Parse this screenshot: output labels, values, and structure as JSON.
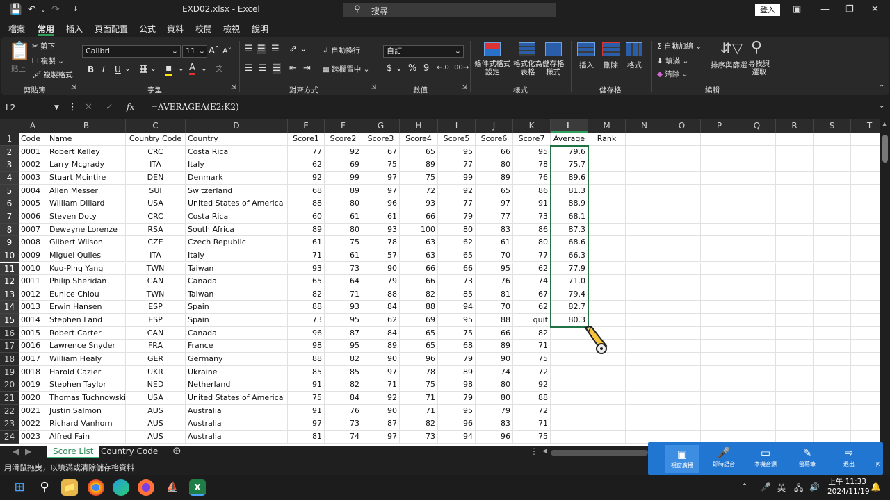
{
  "titlebar": {
    "doc_title": "EXD02.xlsx  -  Excel",
    "search_placeholder": "搜尋",
    "login_label": "登入"
  },
  "menu": {
    "tabs": [
      "檔案",
      "常用",
      "插入",
      "頁面配置",
      "公式",
      "資料",
      "校閱",
      "檢視",
      "說明"
    ],
    "active": "常用",
    "share_label": "共用"
  },
  "ribbon": {
    "clipboard": {
      "paste": "貼上",
      "cut": "剪下",
      "copy": "複製",
      "format_painter": "複製格式",
      "group": "剪貼簿"
    },
    "font": {
      "name": "Calibri",
      "size": "11",
      "group": "字型",
      "bold": "B",
      "italic": "I",
      "underline": "U"
    },
    "alignment": {
      "wrap": "自動換行",
      "merge": "跨欄置中",
      "group": "對齊方式"
    },
    "number": {
      "format": "自訂",
      "group": "數值",
      "currency": "$",
      "percent": "%",
      "comma": "9"
    },
    "styles": {
      "conditional": "條件式格式\n設定",
      "as_table": "格式化為\n表格",
      "cell_styles": "儲存格\n樣式",
      "group": "樣式"
    },
    "cells": {
      "insert": "插入",
      "delete": "刪除",
      "format": "格式",
      "group": "儲存格"
    },
    "editing": {
      "autosum": "自動加總",
      "fill": "填滿",
      "clear": "清除",
      "sort": "排序與篩選",
      "find": "尋找與\n選取",
      "group": "編輯"
    }
  },
  "formula_bar": {
    "name_box": "L2",
    "formula": "=AVERAGEA(E2:K2)",
    "fx": "fx"
  },
  "columns": [
    "A",
    "B",
    "C",
    "D",
    "E",
    "F",
    "G",
    "H",
    "I",
    "J",
    "K",
    "L",
    "M",
    "N",
    "O",
    "P",
    "Q",
    "R",
    "S",
    "T"
  ],
  "headers": [
    "Code",
    "Name",
    "Country Code",
    "Country",
    "Score1",
    "Score2",
    "Score3",
    "Score4",
    "Score5",
    "Score6",
    "Score7",
    "Average",
    "Rank"
  ],
  "rows": [
    [
      "0001",
      "Robert Kelley",
      "CRC",
      "Costa Rica",
      "77",
      "92",
      "67",
      "65",
      "95",
      "66",
      "95",
      "79.6"
    ],
    [
      "0002",
      "Larry Mcgrady",
      "ITA",
      "Italy",
      "62",
      "69",
      "75",
      "89",
      "77",
      "80",
      "78",
      "75.7"
    ],
    [
      "0003",
      "Stuart Mcintire",
      "DEN",
      "Denmark",
      "92",
      "99",
      "97",
      "75",
      "99",
      "89",
      "76",
      "89.6"
    ],
    [
      "0004",
      "Allen Messer",
      "SUI",
      "Switzerland",
      "68",
      "89",
      "97",
      "72",
      "92",
      "65",
      "86",
      "81.3"
    ],
    [
      "0005",
      "William Dillard",
      "USA",
      "United States of America",
      "88",
      "80",
      "96",
      "93",
      "77",
      "97",
      "91",
      "88.9"
    ],
    [
      "0006",
      "Steven Doty",
      "CRC",
      "Costa Rica",
      "60",
      "61",
      "61",
      "66",
      "79",
      "77",
      "73",
      "68.1"
    ],
    [
      "0007",
      "Dewayne Lorenze",
      "RSA",
      "South Africa",
      "89",
      "80",
      "93",
      "100",
      "80",
      "83",
      "86",
      "87.3"
    ],
    [
      "0008",
      "Gilbert Wilson",
      "CZE",
      "Czech Republic",
      "61",
      "75",
      "78",
      "63",
      "62",
      "61",
      "80",
      "68.6"
    ],
    [
      "0009",
      "Miguel Quiles",
      "ITA",
      "Italy",
      "71",
      "61",
      "57",
      "63",
      "65",
      "70",
      "77",
      "66.3"
    ],
    [
      "0010",
      "Kuo-Ping Yang",
      "TWN",
      "Taiwan",
      "93",
      "73",
      "90",
      "66",
      "66",
      "95",
      "62",
      "77.9"
    ],
    [
      "0011",
      "Philip Sheridan",
      "CAN",
      "Canada",
      "65",
      "64",
      "79",
      "66",
      "73",
      "76",
      "74",
      "71.0"
    ],
    [
      "0012",
      "Eunice Chiou",
      "TWN",
      "Taiwan",
      "82",
      "71",
      "88",
      "82",
      "85",
      "81",
      "67",
      "79.4"
    ],
    [
      "0013",
      "Erwin Hansen",
      "ESP",
      "Spain",
      "88",
      "93",
      "84",
      "88",
      "94",
      "70",
      "62",
      "82.7"
    ],
    [
      "0014",
      "Stephen Land",
      "ESP",
      "Spain",
      "73",
      "95",
      "62",
      "69",
      "95",
      "88",
      "quit",
      "80.3"
    ],
    [
      "0015",
      "Robert Carter",
      "CAN",
      "Canada",
      "96",
      "87",
      "84",
      "65",
      "75",
      "66",
      "82",
      ""
    ],
    [
      "0016",
      "Lawrence Snyder",
      "FRA",
      "France",
      "98",
      "95",
      "89",
      "65",
      "68",
      "89",
      "71",
      ""
    ],
    [
      "0017",
      "William Healy",
      "GER",
      "Germany",
      "88",
      "82",
      "90",
      "96",
      "79",
      "90",
      "75",
      ""
    ],
    [
      "0018",
      "Harold Cazier",
      "UKR",
      "Ukraine",
      "85",
      "85",
      "97",
      "78",
      "89",
      "74",
      "72",
      ""
    ],
    [
      "0019",
      "Stephen Taylor",
      "NED",
      "Netherland",
      "91",
      "82",
      "71",
      "75",
      "98",
      "80",
      "92",
      ""
    ],
    [
      "0020",
      "Thomas Tuchnowski",
      "USA",
      "United States of America",
      "75",
      "84",
      "92",
      "71",
      "79",
      "80",
      "88",
      ""
    ],
    [
      "0021",
      "Justin Salmon",
      "AUS",
      "Australia",
      "91",
      "76",
      "90",
      "71",
      "95",
      "79",
      "72",
      ""
    ],
    [
      "0022",
      "Richard Vanhorn",
      "AUS",
      "Australia",
      "97",
      "73",
      "87",
      "82",
      "96",
      "83",
      "71",
      ""
    ],
    [
      "0023",
      "Alfred Fain",
      "AUS",
      "Australia",
      "81",
      "74",
      "97",
      "73",
      "94",
      "96",
      "75",
      ""
    ]
  ],
  "sheets": {
    "tabs": [
      "Score List",
      "Country Code"
    ],
    "active": "Score List"
  },
  "status": {
    "text": "用滑鼠拖曳，以填滿或清除儲存格資料"
  },
  "cast_panel": {
    "items": [
      "視窗廣播",
      "即時語音",
      "本機音源",
      "螢幕筆",
      "退出"
    ]
  },
  "taskbar": {
    "ime": "英",
    "time": "上午 11:33",
    "date": "2024/11/19"
  },
  "colors": {
    "accent": "#217346",
    "active_tab": "#2e9d5b",
    "cast_panel": "#2176d2"
  }
}
